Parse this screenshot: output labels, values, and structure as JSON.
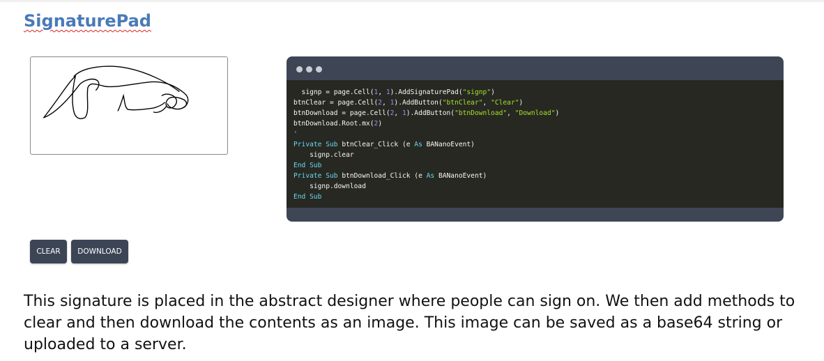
{
  "title": "SignaturePad",
  "code": {
    "lines": [
      [
        {
          "t": "  signp = page.Cell(",
          "c": ""
        },
        {
          "t": "1",
          "c": "num"
        },
        {
          "t": ", ",
          "c": ""
        },
        {
          "t": "1",
          "c": "num"
        },
        {
          "t": ").AddSignaturePad(",
          "c": ""
        },
        {
          "t": "\"signp\"",
          "c": "str"
        },
        {
          "t": ")",
          "c": ""
        }
      ],
      [
        {
          "t": "btnClear = page.Cell(",
          "c": ""
        },
        {
          "t": "2",
          "c": "num"
        },
        {
          "t": ", ",
          "c": ""
        },
        {
          "t": "1",
          "c": "num"
        },
        {
          "t": ").AddButton(",
          "c": ""
        },
        {
          "t": "\"btnClear\"",
          "c": "str"
        },
        {
          "t": ", ",
          "c": ""
        },
        {
          "t": "\"Clear\"",
          "c": "str"
        },
        {
          "t": ")",
          "c": ""
        }
      ],
      [
        {
          "t": "btnDownload = page.Cell(",
          "c": ""
        },
        {
          "t": "2",
          "c": "num"
        },
        {
          "t": ", ",
          "c": ""
        },
        {
          "t": "1",
          "c": "num"
        },
        {
          "t": ").AddButton(",
          "c": ""
        },
        {
          "t": "\"btnDownload\"",
          "c": "str"
        },
        {
          "t": ", ",
          "c": ""
        },
        {
          "t": "\"Download\"",
          "c": "str"
        },
        {
          "t": ")",
          "c": ""
        }
      ],
      [
        {
          "t": "btnDownload.Root.mx(",
          "c": ""
        },
        {
          "t": "2",
          "c": "num"
        },
        {
          "t": ")",
          "c": ""
        }
      ],
      [
        {
          "t": "'",
          "c": "kw"
        }
      ],
      [
        {
          "t": "Private",
          "c": "kw"
        },
        {
          "t": " ",
          "c": ""
        },
        {
          "t": "Sub",
          "c": "kw"
        },
        {
          "t": " btnClear_Click (e ",
          "c": ""
        },
        {
          "t": "As",
          "c": "kw"
        },
        {
          "t": " BANanoEvent)",
          "c": ""
        }
      ],
      [
        {
          "t": "    signp.clear",
          "c": ""
        }
      ],
      [
        {
          "t": "End",
          "c": "kw"
        },
        {
          "t": " ",
          "c": ""
        },
        {
          "t": "Sub",
          "c": "kw"
        }
      ],
      [
        {
          "t": "Private",
          "c": "kw"
        },
        {
          "t": " ",
          "c": ""
        },
        {
          "t": "Sub",
          "c": "kw"
        },
        {
          "t": " btnDownload_Click (e ",
          "c": ""
        },
        {
          "t": "As",
          "c": "kw"
        },
        {
          "t": " BANanoEvent)",
          "c": ""
        }
      ],
      [
        {
          "t": "    signp.download",
          "c": ""
        }
      ],
      [
        {
          "t": "End",
          "c": "kw"
        },
        {
          "t": " ",
          "c": ""
        },
        {
          "t": "Sub",
          "c": "kw"
        }
      ]
    ]
  },
  "buttons": {
    "clear_label": "CLEAR",
    "download_label": "DOWNLOAD"
  },
  "description": "This signature is placed in the abstract designer where people can sign on. We then add methods to clear and then download the contents as an image. This image can be saved as a base64 string or uploaded to a server.",
  "colors": {
    "title": "#4a7ab8",
    "button_bg": "#3c4556",
    "code_bg": "#272822",
    "window_bg": "#3e4656"
  }
}
